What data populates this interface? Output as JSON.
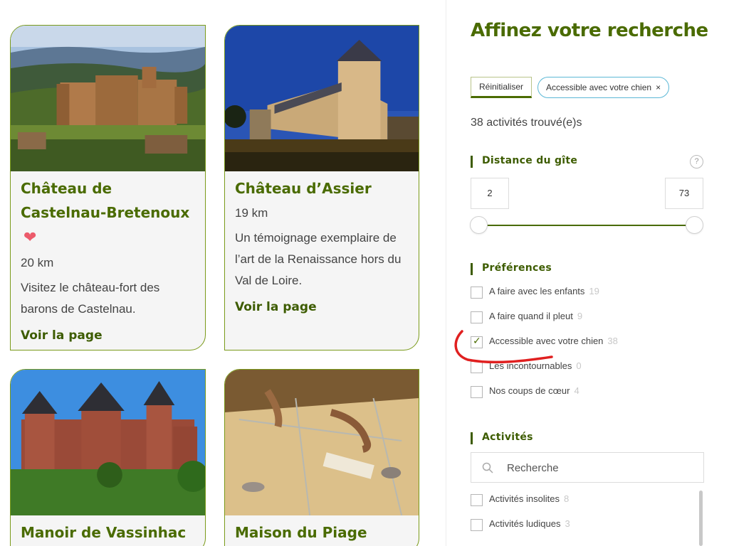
{
  "colors": {
    "brand_green": "#4a6b00",
    "card_bg": "#f5f5f5",
    "heart": "#ec5b6b",
    "chip_border": "#5cb8d6",
    "annotation_red": "#e02020"
  },
  "cards": [
    {
      "title": "Château de Castelnau-Bretenoux",
      "favorite": true,
      "distance": "20 km",
      "description": "Visitez le château-fort des barons de Castelnau.",
      "link": "Voir la page"
    },
    {
      "title": "Château d’Assier",
      "favorite": false,
      "distance": "19 km",
      "description": "Un témoignage exemplaire de l’art de la Renaissance hors du Val de Loire.",
      "link": "Voir la page"
    },
    {
      "title": "Manoir de Vassinhac"
    },
    {
      "title": "Maison du Piage"
    }
  ],
  "sidebar": {
    "title": "Affinez votre recherche",
    "reset_label": "Réinitialiser",
    "active_filter": "Accessible avec votre chien",
    "active_filter_remove": "×",
    "results": "38 activités trouvé(e)s",
    "distance": {
      "heading": "Distance du gîte",
      "help": "?",
      "min": "2",
      "max": "73"
    },
    "preferences": {
      "heading": "Préférences",
      "options": [
        {
          "label": "A faire avec les enfants",
          "count": "19",
          "checked": false
        },
        {
          "label": "A faire quand il pleut",
          "count": "9",
          "checked": false
        },
        {
          "label": "Accessible avec votre chien",
          "count": "38",
          "checked": true
        },
        {
          "label": "Les incontournables",
          "count": "0",
          "checked": false
        },
        {
          "label": "Nos coups de cœur",
          "count": "4",
          "checked": false
        }
      ]
    },
    "activities": {
      "heading": "Activités",
      "search_placeholder": "Recherche",
      "options": [
        {
          "label": "Activités insolites",
          "count": "8",
          "checked": false
        },
        {
          "label": "Activités ludiques",
          "count": "3",
          "checked": false
        }
      ]
    }
  }
}
